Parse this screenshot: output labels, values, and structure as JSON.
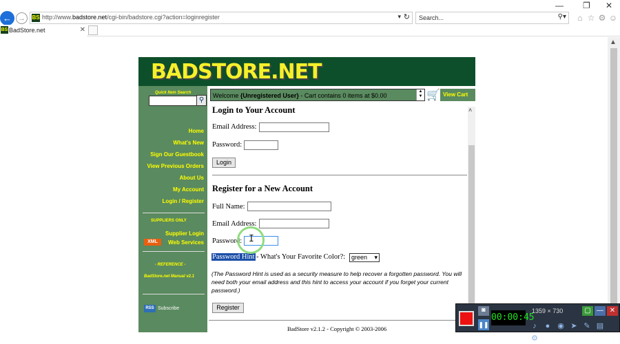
{
  "window": {
    "minimize": "—",
    "restore": "❐",
    "close": "✕"
  },
  "browser": {
    "url_prefix": "http://www.",
    "url_host": "badstore.net",
    "url_path": "/cgi-bin/badstore.cgi?action=loginregister",
    "search_placeholder": "Search...",
    "favicon": "BS",
    "tab_title": "BadStore.net"
  },
  "site": {
    "logo": "BADSTORE.NET",
    "quick_search": "Quick Item Search",
    "nav": [
      "Home",
      "What's New",
      "Sign Our Guestbook",
      "View Previous Orders",
      "About Us",
      "My Account",
      "Login / Register"
    ],
    "suppliers_only": "SUPPLIERS ONLY",
    "supplier_login": "Supplier Login",
    "xml_badge": "XML",
    "web_services": "Web Services",
    "reference": "- REFERENCE -",
    "manual": "BadStore.net Manual v2.1",
    "rss_badge": "RSS",
    "subscribe": "Subscribe",
    "welcome_pre": "Welcome ",
    "welcome_user": "{Unregistered User}",
    "welcome_post": " - Cart contains 0 items at $0.00",
    "view_cart": "View Cart"
  },
  "login": {
    "heading": "Login to Your Account",
    "email_label": "Email Address:",
    "password_label": "Password:",
    "button": "Login"
  },
  "register": {
    "heading": "Register for a New Account",
    "fullname_label": "Full Name:",
    "email_label": "Email Address:",
    "password_label": "Password:",
    "hint_label": "Password Hint",
    "hint_question": " - What's Your Favorite Color?:",
    "color_selected": "green",
    "note": "(The Password Hint is used as a security measure to help recover a forgotten password. You will need both your email address and this hint to access your account if you forget your current password.)",
    "button": "Register"
  },
  "footer": "BadStore v2.1.2 - Copyright © 2003-2006",
  "recorder": {
    "timer": "00:00:45",
    "dims": "1359 × 730"
  }
}
